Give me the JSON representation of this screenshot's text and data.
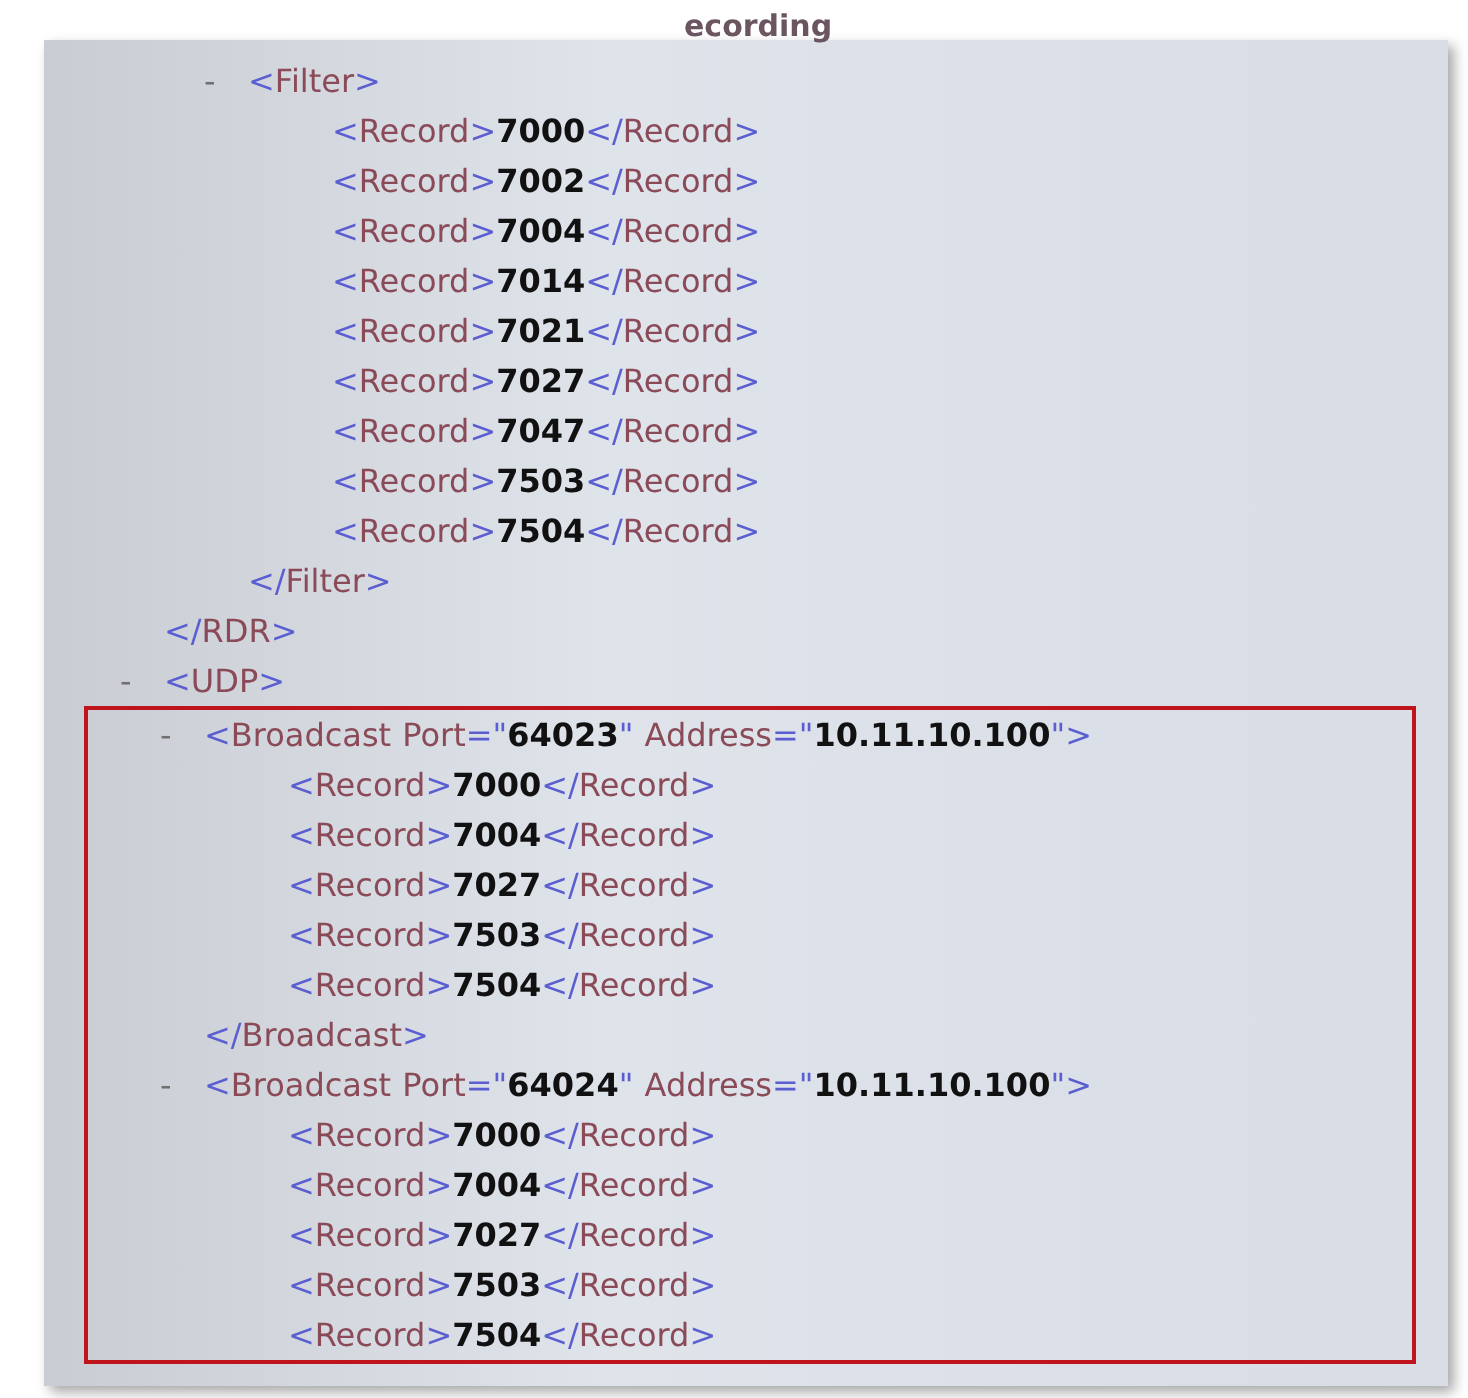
{
  "caption_fragment": "ecording",
  "syntax": {
    "open": "<",
    "close_open": "</",
    "end": ">",
    "equals": "=",
    "quote": "\""
  },
  "tree": [
    {
      "close_tag": "RDR",
      "children": [
        {
          "tag": "Filter",
          "toggle": "-",
          "close_tag": "Filter",
          "children": [
            {
              "tag": "Record",
              "text": "7000",
              "close_tag": "Record"
            },
            {
              "tag": "Record",
              "text": "7002",
              "close_tag": "Record"
            },
            {
              "tag": "Record",
              "text": "7004",
              "close_tag": "Record"
            },
            {
              "tag": "Record",
              "text": "7014",
              "close_tag": "Record"
            },
            {
              "tag": "Record",
              "text": "7021",
              "close_tag": "Record"
            },
            {
              "tag": "Record",
              "text": "7027",
              "close_tag": "Record"
            },
            {
              "tag": "Record",
              "text": "7047",
              "close_tag": "Record"
            },
            {
              "tag": "Record",
              "text": "7503",
              "close_tag": "Record"
            },
            {
              "tag": "Record",
              "text": "7504",
              "close_tag": "Record"
            }
          ]
        }
      ]
    },
    {
      "tag": "UDP",
      "toggle": "-",
      "children_highlighted": true,
      "children": [
        {
          "tag": "Broadcast",
          "toggle": "-",
          "close_tag": "Broadcast",
          "attributes": [
            {
              "name": "Port",
              "value": "64023"
            },
            {
              "name": "Address",
              "value": "10.11.10.100"
            }
          ],
          "children": [
            {
              "tag": "Record",
              "text": "7000",
              "close_tag": "Record"
            },
            {
              "tag": "Record",
              "text": "7004",
              "close_tag": "Record"
            },
            {
              "tag": "Record",
              "text": "7027",
              "close_tag": "Record"
            },
            {
              "tag": "Record",
              "text": "7503",
              "close_tag": "Record"
            },
            {
              "tag": "Record",
              "text": "7504",
              "close_tag": "Record"
            }
          ]
        },
        {
          "tag": "Broadcast",
          "toggle": "-",
          "attributes": [
            {
              "name": "Port",
              "value": "64024"
            },
            {
              "name": "Address",
              "value": "10.11.10.100"
            }
          ],
          "children": [
            {
              "tag": "Record",
              "text": "7000",
              "close_tag": "Record"
            },
            {
              "tag": "Record",
              "text": "7004",
              "close_tag": "Record"
            },
            {
              "tag": "Record",
              "text": "7027",
              "close_tag": "Record"
            },
            {
              "tag": "Record",
              "text": "7503",
              "close_tag": "Record"
            },
            {
              "tag": "Record",
              "text": "7504",
              "close_tag": "Record"
            }
          ]
        }
      ]
    }
  ]
}
